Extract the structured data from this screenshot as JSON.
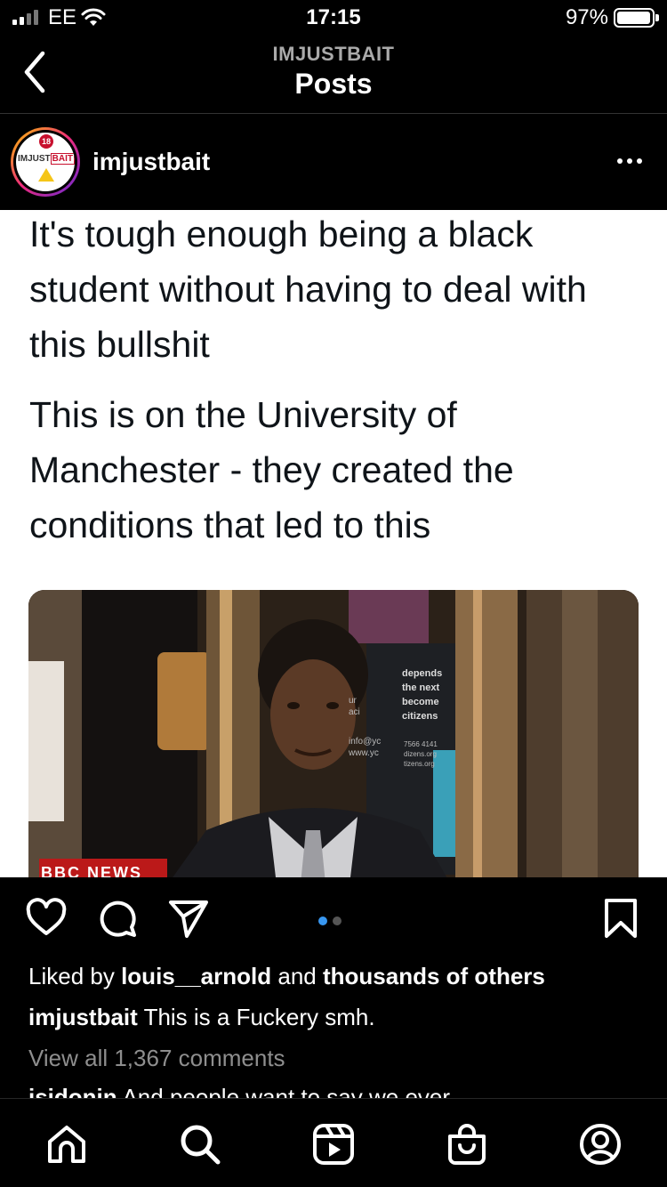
{
  "status_bar": {
    "carrier": "EE",
    "time": "17:15",
    "battery": "97%",
    "battery_level": 0.97
  },
  "header": {
    "account": "IMJUSTBAIT",
    "title": "Posts"
  },
  "post": {
    "username": "imjustbait",
    "avatar": {
      "badge": "18",
      "logo_text_a": "IMJUST",
      "logo_text_b": "BAIT"
    },
    "text_paragraph_1": "It's tough enough being a black student without having to deal with this bullshit",
    "text_paragraph_2": "This is on the University of Manchester - they created the conditions that led to this",
    "photo": {
      "sign_lines": [
        "depends",
        "the next",
        "become",
        "citizens"
      ],
      "sign_small": [
        "7566 4141",
        "dizens.org",
        "tizens.org"
      ],
      "sign_left": [
        "ur",
        "aci",
        "info@yc",
        "www.yc"
      ],
      "banner": "BBC NEWS"
    },
    "carousel": {
      "count": 2,
      "active_index": 0
    },
    "likes": {
      "prefix": "Liked by",
      "user": "louis__arnold",
      "connector": "and",
      "others": "thousands of others"
    },
    "caption": {
      "user": "imjustbait",
      "text": "This is a Fuckery smh."
    },
    "view_comments": "View all 1,367 comments",
    "comment_preview": {
      "user": "isidonin",
      "text": "And people want to say we ever"
    }
  },
  "icons": {
    "back": "chevron-left-icon",
    "more": "more-horizontal-icon",
    "like": "heart-icon",
    "comment": "comment-icon",
    "share": "send-icon",
    "save": "bookmark-icon",
    "tabs": [
      "home-icon",
      "search-icon",
      "reels-icon",
      "shop-icon",
      "profile-icon"
    ]
  },
  "colors": {
    "carousel_active": "#3897f0",
    "avatar_ring": "#ee2a7b"
  }
}
